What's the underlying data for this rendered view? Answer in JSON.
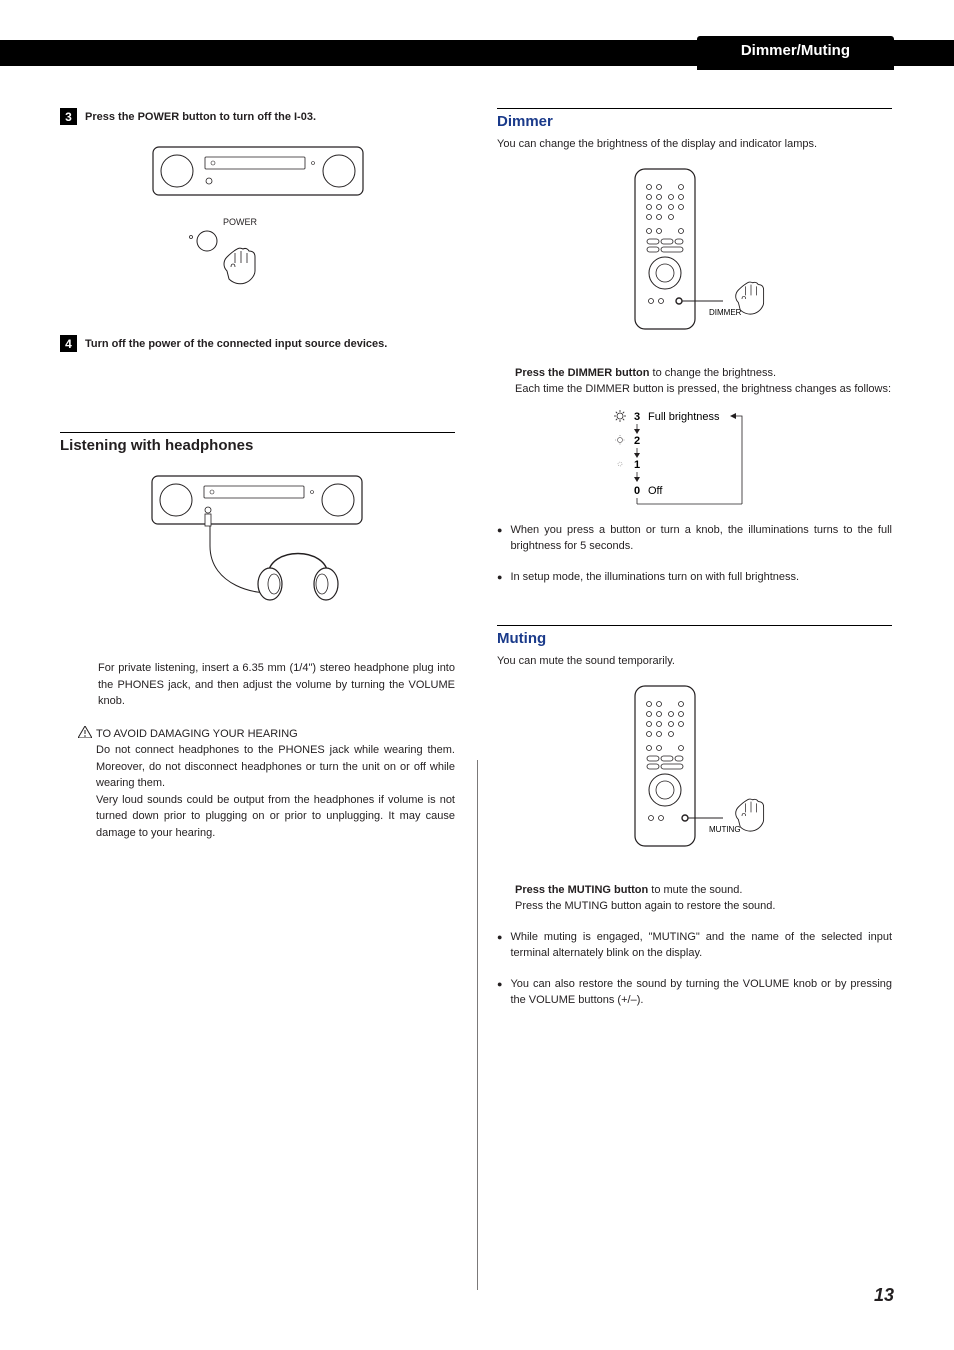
{
  "header": {
    "tab": "Dimmer/Muting"
  },
  "left": {
    "step3": {
      "num": "3",
      "text": "Press the POWER button to turn off the I-03."
    },
    "power_label": "POWER",
    "step4": {
      "num": "4",
      "text": "Turn off the power of the connected input source devices."
    },
    "headphones_title": "Listening with headphones",
    "headphones_body": "For private listening, insert a 6.35 mm (1/4\") stereo headphone plug into the PHONES jack, and then adjust the volume by turning the VOLUME knob.",
    "warn_title": "TO AVOID DAMAGING YOUR HEARING",
    "warn_body1": "Do not connect headphones to the PHONES jack while wearing them. Moreover, do not disconnect headphones or turn the unit on or off while wearing them.",
    "warn_body2": "Very loud sounds could be output from the headphones if volume is not turned down prior to plugging on or prior to unplugging. It may cause damage to your hearing."
  },
  "right": {
    "dimmer_title": "Dimmer",
    "dimmer_intro": "You can change the brightness of the display and indicator lamps.",
    "dimmer_label": "DIMMER",
    "dimmer_press_bold": "Press the DIMMER button",
    "dimmer_press_rest": " to change the brightness.",
    "dimmer_each": "Each time the DIMMER button is pressed, the brightness changes as follows:",
    "levels": {
      "l3": "3",
      "l3_label": "Full brightness",
      "l2": "2",
      "l1": "1",
      "l0": "0",
      "l0_label": "Off"
    },
    "dimmer_bullet1": "When you press a button or turn a knob, the illuminations turns to the full brightness for 5 seconds.",
    "dimmer_bullet2": "In setup mode, the illuminations turn on with full brightness.",
    "muting_title": "Muting",
    "muting_intro": "You can mute the sound temporarily.",
    "muting_label": "MUTING",
    "muting_press_bold": "Press the MUTING button",
    "muting_press_rest": " to mute the sound.",
    "muting_again": "Press the MUTING button again to restore the sound.",
    "muting_bullet1": "While muting is engaged, \"MUTING\" and the name of the selected input terminal alternately blink on the display.",
    "muting_bullet2": "You can also restore the sound by turning the VOLUME knob or by pressing the VOLUME buttons (+/–)."
  },
  "page": "13"
}
